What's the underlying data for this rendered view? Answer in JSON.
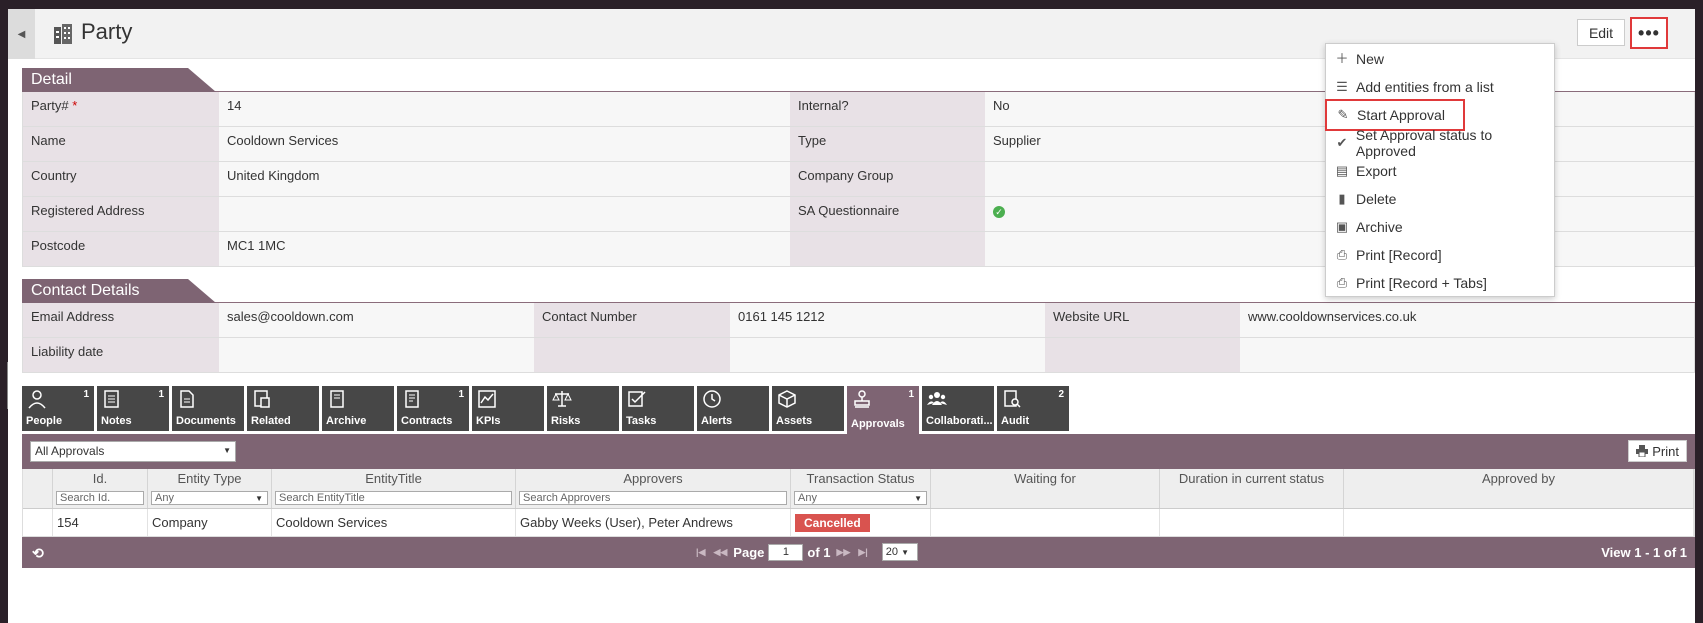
{
  "header": {
    "title": "Party",
    "edit_label": "Edit",
    "more_label": "•••"
  },
  "detail": {
    "section_title": "Detail",
    "rows": [
      {
        "l1": "Party#",
        "v1": "14",
        "l2": "Internal?",
        "v2": "No"
      },
      {
        "l1": "Name",
        "v1": "Cooldown Services",
        "l2": "Type",
        "v2": "Supplier"
      },
      {
        "l1": "Country",
        "v1": "United Kingdom",
        "l2": "Company Group",
        "v2": ""
      },
      {
        "l1": "Registered Address",
        "v1": "",
        "l2": "SA Questionnaire",
        "v2": ""
      },
      {
        "l1": "Postcode",
        "v1": "MC1 1MC",
        "l2": "",
        "v2": ""
      }
    ],
    "required_mark": "*"
  },
  "contact": {
    "section_title": "Contact Details",
    "row1": {
      "l1": "Email Address",
      "v1": "sales@cooldown.com",
      "l2": "Contact Number",
      "v2": "0161 145 1212",
      "l3": "Website URL",
      "v3": "www.cooldownservices.co.uk"
    },
    "row2": {
      "l1": "Liability date"
    }
  },
  "tabs": [
    {
      "label": "People",
      "count": "1",
      "icon": "person-icon"
    },
    {
      "label": "Notes",
      "count": "1",
      "icon": "notes-icon"
    },
    {
      "label": "Documents",
      "count": "",
      "icon": "document-icon"
    },
    {
      "label": "Related",
      "count": "",
      "icon": "related-icon"
    },
    {
      "label": "Archive",
      "count": "",
      "icon": "archive-icon"
    },
    {
      "label": "Contracts",
      "count": "1",
      "icon": "contract-icon"
    },
    {
      "label": "KPIs",
      "count": "",
      "icon": "chart-icon"
    },
    {
      "label": "Risks",
      "count": "",
      "icon": "scales-icon"
    },
    {
      "label": "Tasks",
      "count": "",
      "icon": "tasks-icon"
    },
    {
      "label": "Alerts",
      "count": "",
      "icon": "clock-icon"
    },
    {
      "label": "Assets",
      "count": "",
      "icon": "cube-icon"
    },
    {
      "label": "Approvals",
      "count": "1",
      "icon": "stamp-icon"
    },
    {
      "label": "Collaborati...",
      "count": "",
      "icon": "group-icon"
    },
    {
      "label": "Audit",
      "count": "2",
      "icon": "audit-icon"
    }
  ],
  "approvals": {
    "filter_value": "All Approvals",
    "print_label": "Print",
    "columns": [
      "Id.",
      "Entity Type",
      "EntityTitle",
      "Approvers",
      "Transaction Status",
      "Waiting for",
      "Duration in current status",
      "Approved by"
    ],
    "filters": {
      "id": "Search  Id.",
      "entity_type": "Any",
      "entity_title": "Search EntityTitle",
      "approvers": "Search Approvers",
      "status": "Any"
    },
    "rows": [
      {
        "id": "154",
        "entity_type": "Company",
        "entity_title": "Cooldown Services",
        "approvers": "Gabby Weeks (User), Peter Andrews",
        "status": "Cancelled",
        "waiting": "",
        "duration": "",
        "approved_by": ""
      }
    ],
    "pager": {
      "page_label": "Page",
      "page": "1",
      "of_label": "of 1",
      "rows_per_page": "20",
      "view_info": "View 1 - 1 of 1"
    }
  },
  "menu": {
    "items": [
      {
        "label": "New",
        "icon": "plus-icon"
      },
      {
        "label": "Add entities from a list",
        "icon": "list-icon"
      },
      {
        "label": "Start Approval",
        "icon": "approval-edit-icon"
      },
      {
        "label": "Set Approval status to Approved",
        "icon": "check-icon"
      },
      {
        "label": "Export",
        "icon": "excel-icon"
      },
      {
        "label": "Delete",
        "icon": "trash-icon"
      },
      {
        "label": "Archive",
        "icon": "archive-box-icon"
      },
      {
        "label": "Print [Record]",
        "icon": "printer-icon"
      },
      {
        "label": "Print [Record + Tabs]",
        "icon": "printer-icon"
      }
    ]
  },
  "colors": {
    "accent": "#7e6473",
    "highlight": "#e0393a",
    "cancelled": "#d9534f"
  }
}
